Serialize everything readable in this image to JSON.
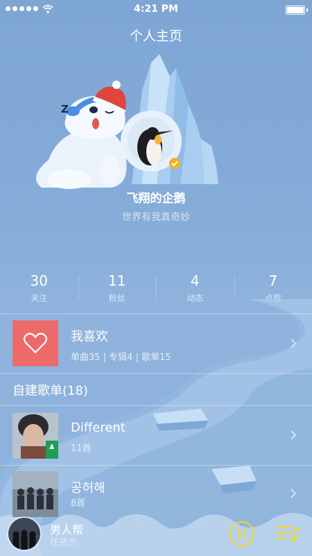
{
  "status_bar": {
    "time": "4:21 PM"
  },
  "header": {
    "title": "个人主页"
  },
  "profile": {
    "nickname": "飞翔的企鹅",
    "bio": "世界有我真奇妙",
    "sleep_text": "Z"
  },
  "stats": [
    {
      "value": "30",
      "label": "关注"
    },
    {
      "value": "11",
      "label": "粉丝"
    },
    {
      "value": "4",
      "label": "动态"
    },
    {
      "value": "7",
      "label": "点歌"
    }
  ],
  "favorites": {
    "title": "我喜欢",
    "subtitle": "单曲35 | 专辑4 | 歌单15"
  },
  "playlists_section": {
    "label": "自建歌单(18)"
  },
  "playlists": [
    {
      "title": "Different",
      "count": "11首"
    },
    {
      "title": "공허해",
      "count": "8首"
    }
  ],
  "player": {
    "song": "男人帮",
    "artist": "任贤齐"
  },
  "colors": {
    "accent": "#f5d623",
    "favorite_cover": "#ec6b6a",
    "background": "#86acd8"
  }
}
